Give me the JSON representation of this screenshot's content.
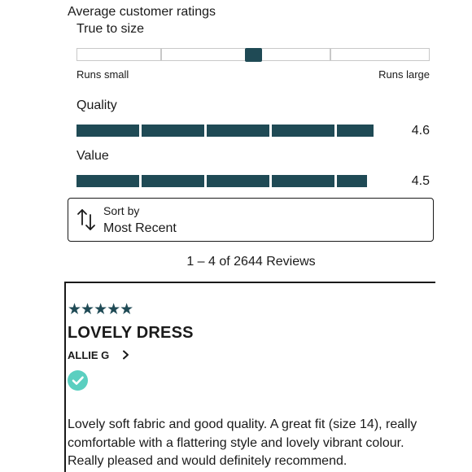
{
  "ratings": {
    "heading": "Average customer ratings",
    "true_to_size": {
      "label": "True to size",
      "min_label": "Runs small",
      "max_label": "Runs large",
      "position": 0.5
    },
    "quality": {
      "label": "Quality",
      "value": "4.6",
      "score": 4.6
    },
    "value": {
      "label": "Value",
      "value": "4.5",
      "score": 4.5
    }
  },
  "sort": {
    "label": "Sort by",
    "selected": "Most Recent",
    "icon": "sort-arrows-icon"
  },
  "reviews_count": "1 – 4 of 2644 Reviews",
  "review": {
    "stars": "★★★★★",
    "rating": 5,
    "title": "LOVELY DRESS",
    "author": "ALLIE G",
    "verified_icon": "checkmark-circle-icon",
    "body": "Lovely soft fabric and good quality. A great fit (size 14), really comfortable with a flattering style and lovely vibrant colour. Really pleased and would definitely recommend."
  },
  "colors": {
    "accent": "#1f4a55",
    "verified": "#5bcfc0"
  }
}
